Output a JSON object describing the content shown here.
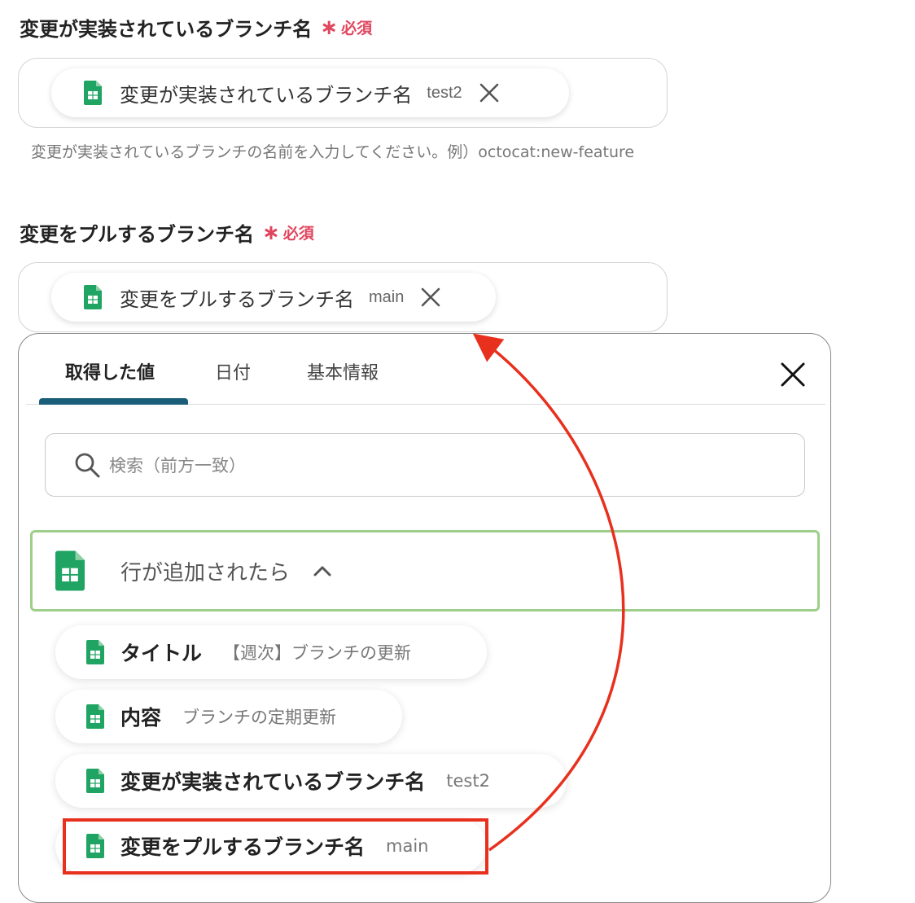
{
  "fields": [
    {
      "label": "変更が実装されているブランチ名",
      "required_mark": "∗",
      "required_text": "必須",
      "chip_label": "変更が実装されているブランチ名",
      "chip_value": "test2",
      "helper": "変更が実装されているブランチの名前を入力してください。例）octocat:new-feature"
    },
    {
      "label": "変更をプルするブランチ名",
      "required_mark": "∗",
      "required_text": "必須",
      "chip_label": "変更をプルするブランチ名",
      "chip_value": "main"
    }
  ],
  "panel": {
    "tabs": [
      {
        "label": "取得した値",
        "active": true
      },
      {
        "label": "日付",
        "active": false
      },
      {
        "label": "基本情報",
        "active": false
      }
    ],
    "search_placeholder": "検索（前方一致）",
    "group_title": "行が追加されたら",
    "items": [
      {
        "label": "タイトル",
        "value": "【週次】ブランチの更新"
      },
      {
        "label": "内容",
        "value": "ブランチの定期更新"
      },
      {
        "label": "変更が実装されているブランチ名",
        "value": "test2"
      },
      {
        "label": "変更をプルするブランチ名",
        "value": "main"
      }
    ]
  },
  "icons": {
    "sheet": "google-sheets-icon",
    "remove": "close-icon",
    "search": "search-icon",
    "chevron": "chevron-up-icon"
  },
  "colors": {
    "required": "#e0465e",
    "sheet_green": "#1fa463",
    "tab_indicator": "#1b5e7a",
    "group_border": "#9ecf8a",
    "highlight": "#e8301e"
  }
}
